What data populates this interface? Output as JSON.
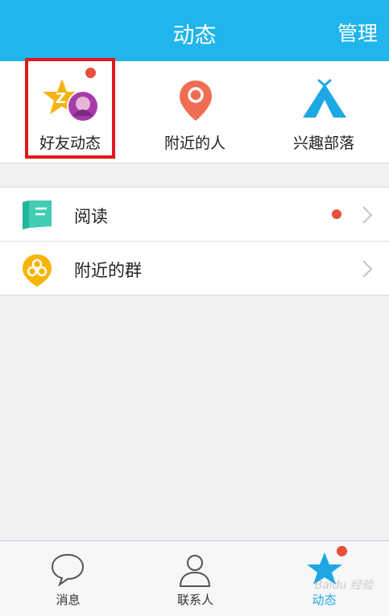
{
  "header": {
    "title": "动态",
    "manage_label": "管理"
  },
  "quick_actions": [
    {
      "label": "好友动态",
      "icon": "star-friends-feed-icon",
      "badge": true
    },
    {
      "label": "附近的人",
      "icon": "location-pin-icon"
    },
    {
      "label": "兴趣部落",
      "icon": "tent-icon"
    }
  ],
  "list": [
    {
      "label": "阅读",
      "icon": "book-icon",
      "badge": true
    },
    {
      "label": "附近的群",
      "icon": "group-pin-icon",
      "badge": false
    }
  ],
  "tabs": [
    {
      "label": "消息",
      "icon": "chat-bubble-icon"
    },
    {
      "label": "联系人",
      "icon": "person-icon"
    },
    {
      "label": "动态",
      "icon": "star-icon",
      "active": true
    }
  ],
  "watermark": "Baidu 经验",
  "colors": {
    "header": "#20b5ec",
    "badge": "#e9503b",
    "highlight": "#e01919",
    "active_tab": "#1ea8e3"
  }
}
